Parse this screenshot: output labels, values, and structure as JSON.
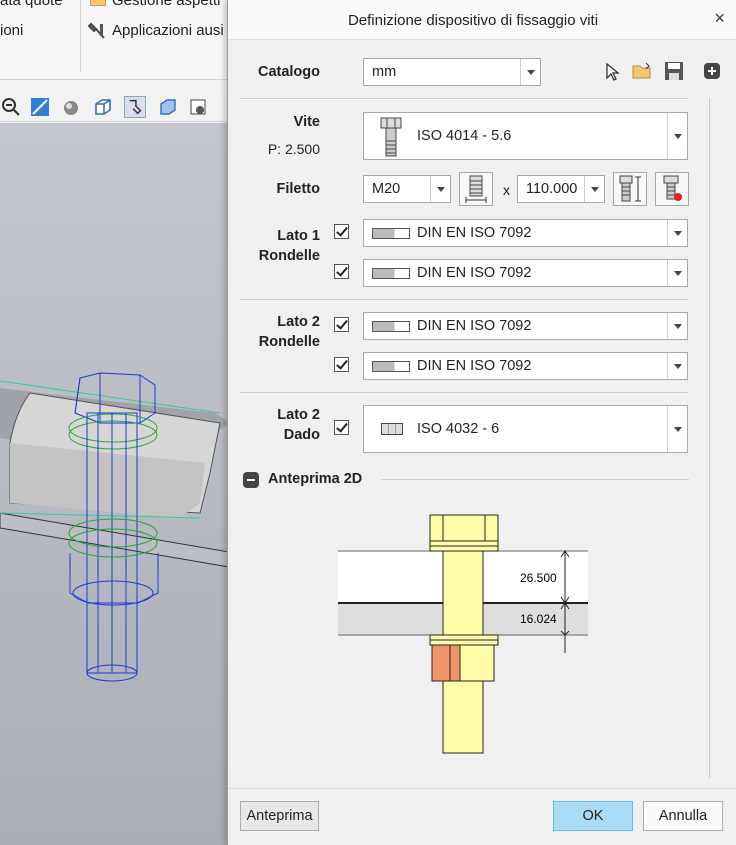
{
  "ribbon": {
    "item1": "ata quote",
    "item2": "ioni",
    "item3": "Gestione aspetti",
    "item4": "Applicazioni ausi"
  },
  "dialog": {
    "title": "Definizione dispositivo di fissaggio viti",
    "close": "×",
    "catalog_label": "Catalogo",
    "catalog_value": "mm",
    "screw_label": "Vite",
    "pitch": "P: 2.500",
    "screw_value": "ISO 4014 - 5.6",
    "thread_label": "Filetto",
    "thread_value": "M20",
    "times": "x",
    "length_value": "110.000",
    "side1_label1": "Lato 1",
    "side1_label2": "Rondelle",
    "side1_washer1": "DIN EN ISO 7092",
    "side1_washer2": "DIN EN ISO 7092",
    "side2_label1": "Lato 2",
    "side2_label2": "Rondelle",
    "side2_washer1": "DIN EN ISO 7092",
    "side2_washer2": "DIN EN ISO 7092",
    "nut_label1": "Lato 2",
    "nut_label2": "Dado",
    "nut_value": "ISO 4032 - 6",
    "preview_section": "Anteprima 2D",
    "dim_top": "26.500",
    "dim_bottom": "16.024",
    "preview_button": "Anteprima",
    "ok_button": "OK",
    "cancel_button": "Annulla"
  },
  "colors": {
    "bolt": "#fdfca8",
    "nut": "#f0956a",
    "ok": "#a8dcf7"
  }
}
